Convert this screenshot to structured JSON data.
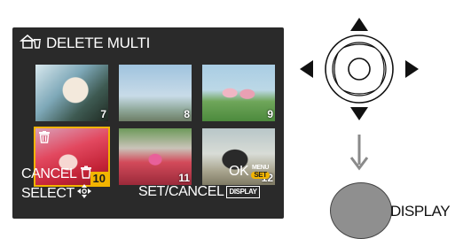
{
  "screen": {
    "title": "DELETE MULTI",
    "thumbnails": [
      {
        "number": "7",
        "scene": "portrait",
        "selected": false,
        "marked_delete": false
      },
      {
        "number": "8",
        "scene": "sky",
        "selected": false,
        "marked_delete": false
      },
      {
        "number": "9",
        "scene": "girls-field",
        "selected": false,
        "marked_delete": false
      },
      {
        "number": "10",
        "scene": "slide-red",
        "selected": true,
        "marked_delete": true
      },
      {
        "number": "11",
        "scene": "slide-child",
        "selected": false,
        "marked_delete": false
      },
      {
        "number": "12",
        "scene": "dog",
        "selected": false,
        "marked_delete": false
      }
    ],
    "cancel_label": "CANCEL",
    "ok_label": "OK",
    "menu_badge_top": "MENU",
    "menu_badge_bottom": "SET",
    "select_label": "SELECT",
    "set_cancel_label": "SET/CANCEL",
    "display_tag": "DISPLAY"
  },
  "controls": {
    "display_button_label": "DISPLAY"
  },
  "colors": {
    "lcd_background": "#2a2a2a",
    "highlight": "#f2b400",
    "button_grey": "#8f8f8f"
  }
}
